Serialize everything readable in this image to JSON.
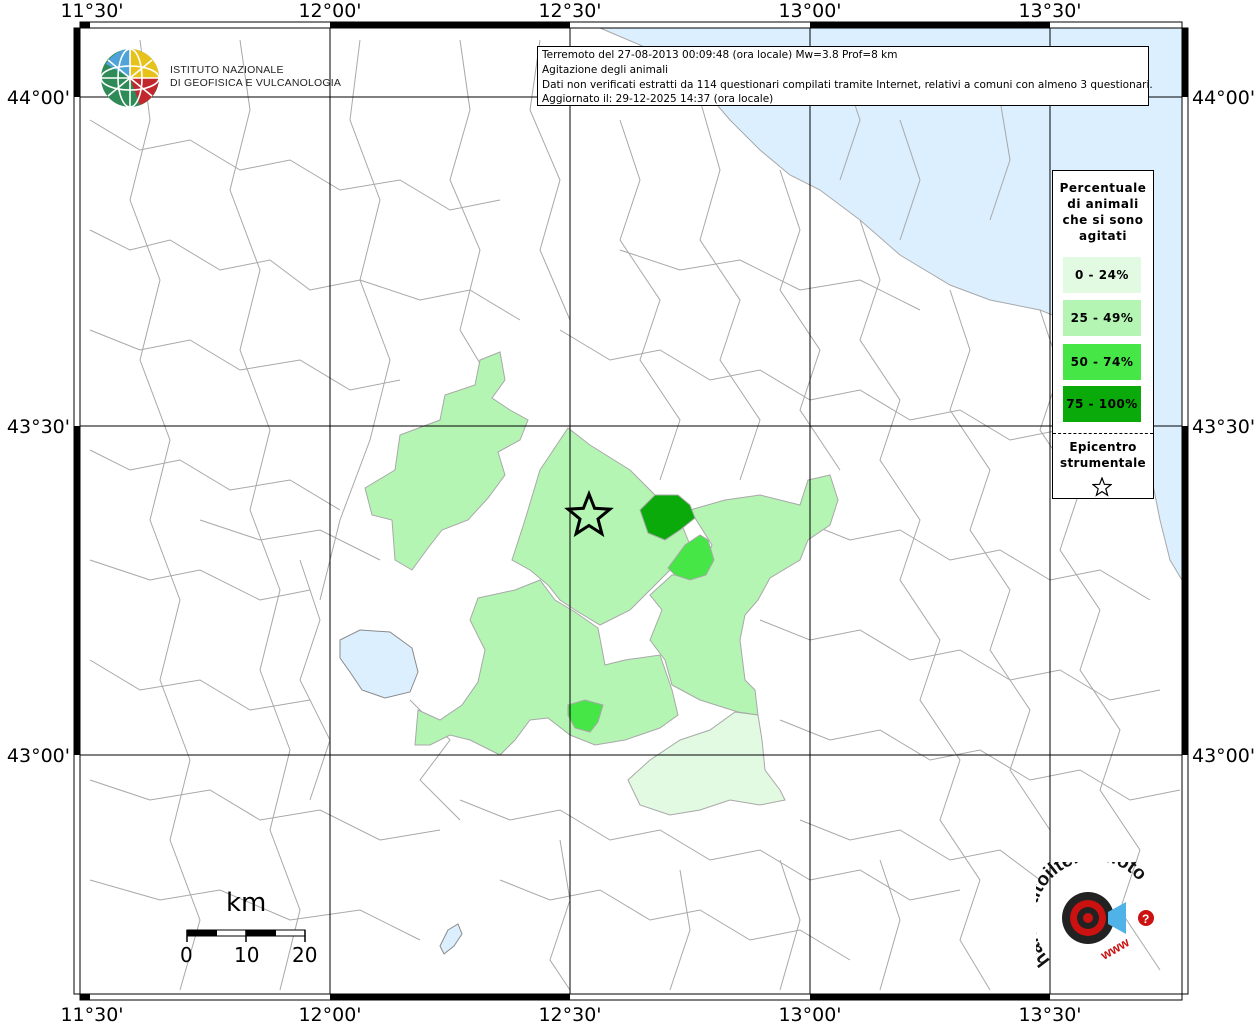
{
  "map": {
    "lon_labels": [
      "11°30'",
      "12°00'",
      "12°30'",
      "13°00'",
      "13°30'"
    ],
    "lat_labels": [
      "44°00'",
      "43°30'",
      "43°00'"
    ]
  },
  "info": {
    "line1": "Terremoto del 27-08-2013 00:09:48 (ora locale) Mw=3.8 Prof=8 km",
    "line2": "Agitazione degli animali",
    "line3": "Dati non verificati estratti da 114 questionari compilati tramite Internet, relativi a comuni con almeno 3 questionari.",
    "line4": "Aggiornato il: 29-12-2025 14:37 (ora locale)"
  },
  "logo": {
    "line1": "ISTITUTO NAZIONALE",
    "line2": "DI GEOFISICA E VULCANOLOGIA",
    "icon": "ingv-globe-logo"
  },
  "legend": {
    "title": [
      "Percentuale",
      "di animali",
      "che si sono",
      "agitati"
    ],
    "classes": [
      {
        "label": "0 - 24%",
        "color": "#e1fae1"
      },
      {
        "label": "25 - 49%",
        "color": "#b4f5b4"
      },
      {
        "label": "50 - 74%",
        "color": "#46e646"
      },
      {
        "label": "75 - 100%",
        "color": "#0aaa0a"
      }
    ],
    "epicenter_label": [
      "Epicentro",
      "strumentale"
    ],
    "epicenter_icon": "star-icon"
  },
  "scale": {
    "title": "km",
    "labels": [
      "0",
      "10",
      "20"
    ]
  },
  "branding": {
    "text": "haisentitoilterremoto.it",
    "url_text": "www",
    "icon": "hsi-logo",
    "accent": "#cc1111"
  },
  "colors": {
    "sea": "#dcefff",
    "border": "#a8a8a8",
    "grid": "#000000"
  }
}
